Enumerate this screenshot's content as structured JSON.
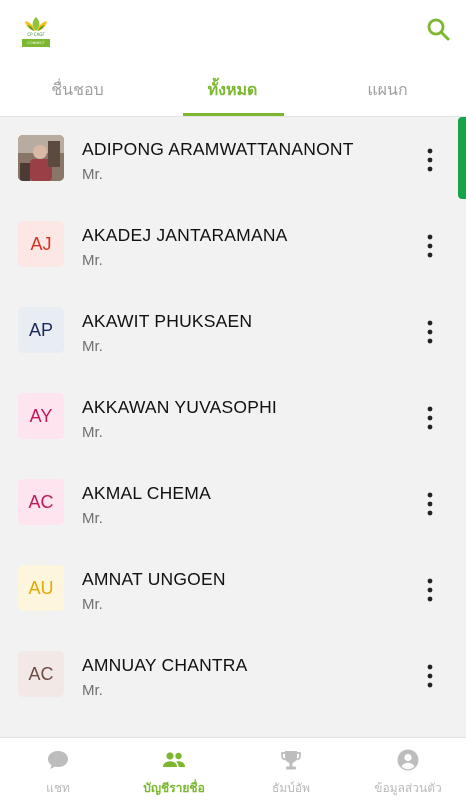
{
  "header": {
    "logo_text": "CP CAGF",
    "logo_subtext": "CONNECT"
  },
  "tabs": [
    {
      "label": "ชื่นชอบ",
      "active": false
    },
    {
      "label": "ทั้งหมด",
      "active": true
    },
    {
      "label": "แผนก",
      "active": false
    }
  ],
  "contacts": [
    {
      "initials": "",
      "name": "ADIPONG ARAMWATTANANONT",
      "title": "Mr.",
      "has_photo": true
    },
    {
      "initials": "AJ",
      "name": "AKADEJ JANTARAMANA",
      "title": "Mr.",
      "bg": "#fde7e4",
      "fg": "#d3321f"
    },
    {
      "initials": "AP",
      "name": "AKAWIT PHUKSAEN",
      "title": "Mr.",
      "bg": "#e8ecf3",
      "fg": "#1a2a5a"
    },
    {
      "initials": "AY",
      "name": "AKKAWAN YUVASOPHI",
      "title": "Mr.",
      "bg": "#fde4ee",
      "fg": "#c2185b"
    },
    {
      "initials": "AC",
      "name": "AKMAL CHEMA",
      "title": "Mr.",
      "bg": "#fde4ef",
      "fg": "#c2185b"
    },
    {
      "initials": "AU",
      "name": "AMNAT UNGOEN",
      "title": "Mr.",
      "bg": "#fdf6dc",
      "fg": "#e0a800"
    },
    {
      "initials": "AC",
      "name": "AMNUAY CHANTRA",
      "title": "Mr.",
      "bg": "#f2e9e7",
      "fg": "#6d4c41"
    }
  ],
  "bottom_nav": [
    {
      "label": "แชท",
      "icon": "chat-bubble-icon",
      "active": false
    },
    {
      "label": "บัญชีรายชื่อ",
      "icon": "people-icon",
      "active": true
    },
    {
      "label": "ธัมบ์อัพ",
      "icon": "trophy-icon",
      "active": false
    },
    {
      "label": "ข้อมูลส่วนตัว",
      "icon": "account-circle-icon",
      "active": false
    }
  ],
  "colors": {
    "accent": "#7cb82f",
    "scrollbar": "#17a34a",
    "inactive": "#b9b9b9"
  }
}
